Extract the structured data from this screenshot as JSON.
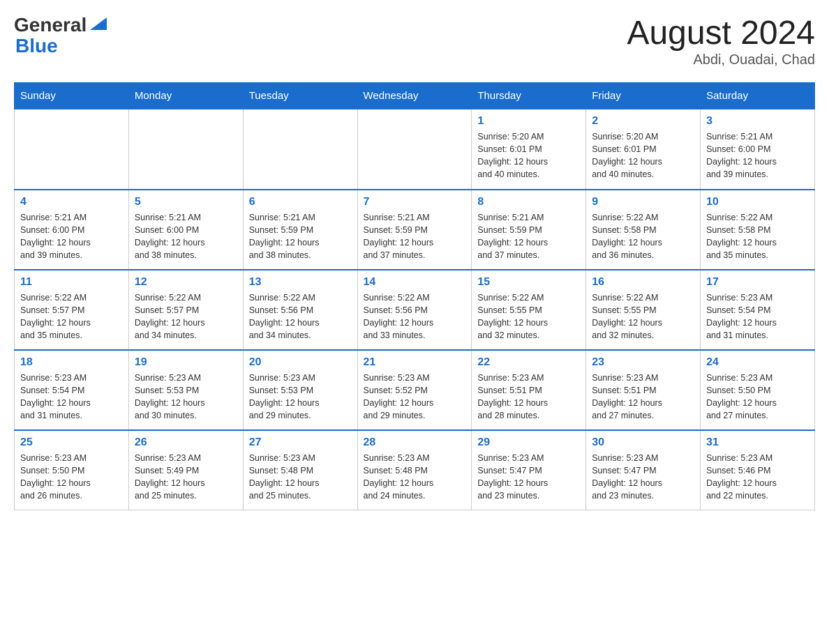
{
  "header": {
    "logo_general": "General",
    "logo_blue": "Blue",
    "month_title": "August 2024",
    "location": "Abdi, Ouadai, Chad"
  },
  "days_of_week": [
    "Sunday",
    "Monday",
    "Tuesday",
    "Wednesday",
    "Thursday",
    "Friday",
    "Saturday"
  ],
  "weeks": [
    [
      {
        "day": "",
        "info": ""
      },
      {
        "day": "",
        "info": ""
      },
      {
        "day": "",
        "info": ""
      },
      {
        "day": "",
        "info": ""
      },
      {
        "day": "1",
        "info": "Sunrise: 5:20 AM\nSunset: 6:01 PM\nDaylight: 12 hours\nand 40 minutes."
      },
      {
        "day": "2",
        "info": "Sunrise: 5:20 AM\nSunset: 6:01 PM\nDaylight: 12 hours\nand 40 minutes."
      },
      {
        "day": "3",
        "info": "Sunrise: 5:21 AM\nSunset: 6:00 PM\nDaylight: 12 hours\nand 39 minutes."
      }
    ],
    [
      {
        "day": "4",
        "info": "Sunrise: 5:21 AM\nSunset: 6:00 PM\nDaylight: 12 hours\nand 39 minutes."
      },
      {
        "day": "5",
        "info": "Sunrise: 5:21 AM\nSunset: 6:00 PM\nDaylight: 12 hours\nand 38 minutes."
      },
      {
        "day": "6",
        "info": "Sunrise: 5:21 AM\nSunset: 5:59 PM\nDaylight: 12 hours\nand 38 minutes."
      },
      {
        "day": "7",
        "info": "Sunrise: 5:21 AM\nSunset: 5:59 PM\nDaylight: 12 hours\nand 37 minutes."
      },
      {
        "day": "8",
        "info": "Sunrise: 5:21 AM\nSunset: 5:59 PM\nDaylight: 12 hours\nand 37 minutes."
      },
      {
        "day": "9",
        "info": "Sunrise: 5:22 AM\nSunset: 5:58 PM\nDaylight: 12 hours\nand 36 minutes."
      },
      {
        "day": "10",
        "info": "Sunrise: 5:22 AM\nSunset: 5:58 PM\nDaylight: 12 hours\nand 35 minutes."
      }
    ],
    [
      {
        "day": "11",
        "info": "Sunrise: 5:22 AM\nSunset: 5:57 PM\nDaylight: 12 hours\nand 35 minutes."
      },
      {
        "day": "12",
        "info": "Sunrise: 5:22 AM\nSunset: 5:57 PM\nDaylight: 12 hours\nand 34 minutes."
      },
      {
        "day": "13",
        "info": "Sunrise: 5:22 AM\nSunset: 5:56 PM\nDaylight: 12 hours\nand 34 minutes."
      },
      {
        "day": "14",
        "info": "Sunrise: 5:22 AM\nSunset: 5:56 PM\nDaylight: 12 hours\nand 33 minutes."
      },
      {
        "day": "15",
        "info": "Sunrise: 5:22 AM\nSunset: 5:55 PM\nDaylight: 12 hours\nand 32 minutes."
      },
      {
        "day": "16",
        "info": "Sunrise: 5:22 AM\nSunset: 5:55 PM\nDaylight: 12 hours\nand 32 minutes."
      },
      {
        "day": "17",
        "info": "Sunrise: 5:23 AM\nSunset: 5:54 PM\nDaylight: 12 hours\nand 31 minutes."
      }
    ],
    [
      {
        "day": "18",
        "info": "Sunrise: 5:23 AM\nSunset: 5:54 PM\nDaylight: 12 hours\nand 31 minutes."
      },
      {
        "day": "19",
        "info": "Sunrise: 5:23 AM\nSunset: 5:53 PM\nDaylight: 12 hours\nand 30 minutes."
      },
      {
        "day": "20",
        "info": "Sunrise: 5:23 AM\nSunset: 5:53 PM\nDaylight: 12 hours\nand 29 minutes."
      },
      {
        "day": "21",
        "info": "Sunrise: 5:23 AM\nSunset: 5:52 PM\nDaylight: 12 hours\nand 29 minutes."
      },
      {
        "day": "22",
        "info": "Sunrise: 5:23 AM\nSunset: 5:51 PM\nDaylight: 12 hours\nand 28 minutes."
      },
      {
        "day": "23",
        "info": "Sunrise: 5:23 AM\nSunset: 5:51 PM\nDaylight: 12 hours\nand 27 minutes."
      },
      {
        "day": "24",
        "info": "Sunrise: 5:23 AM\nSunset: 5:50 PM\nDaylight: 12 hours\nand 27 minutes."
      }
    ],
    [
      {
        "day": "25",
        "info": "Sunrise: 5:23 AM\nSunset: 5:50 PM\nDaylight: 12 hours\nand 26 minutes."
      },
      {
        "day": "26",
        "info": "Sunrise: 5:23 AM\nSunset: 5:49 PM\nDaylight: 12 hours\nand 25 minutes."
      },
      {
        "day": "27",
        "info": "Sunrise: 5:23 AM\nSunset: 5:48 PM\nDaylight: 12 hours\nand 25 minutes."
      },
      {
        "day": "28",
        "info": "Sunrise: 5:23 AM\nSunset: 5:48 PM\nDaylight: 12 hours\nand 24 minutes."
      },
      {
        "day": "29",
        "info": "Sunrise: 5:23 AM\nSunset: 5:47 PM\nDaylight: 12 hours\nand 23 minutes."
      },
      {
        "day": "30",
        "info": "Sunrise: 5:23 AM\nSunset: 5:47 PM\nDaylight: 12 hours\nand 23 minutes."
      },
      {
        "day": "31",
        "info": "Sunrise: 5:23 AM\nSunset: 5:46 PM\nDaylight: 12 hours\nand 22 minutes."
      }
    ]
  ]
}
